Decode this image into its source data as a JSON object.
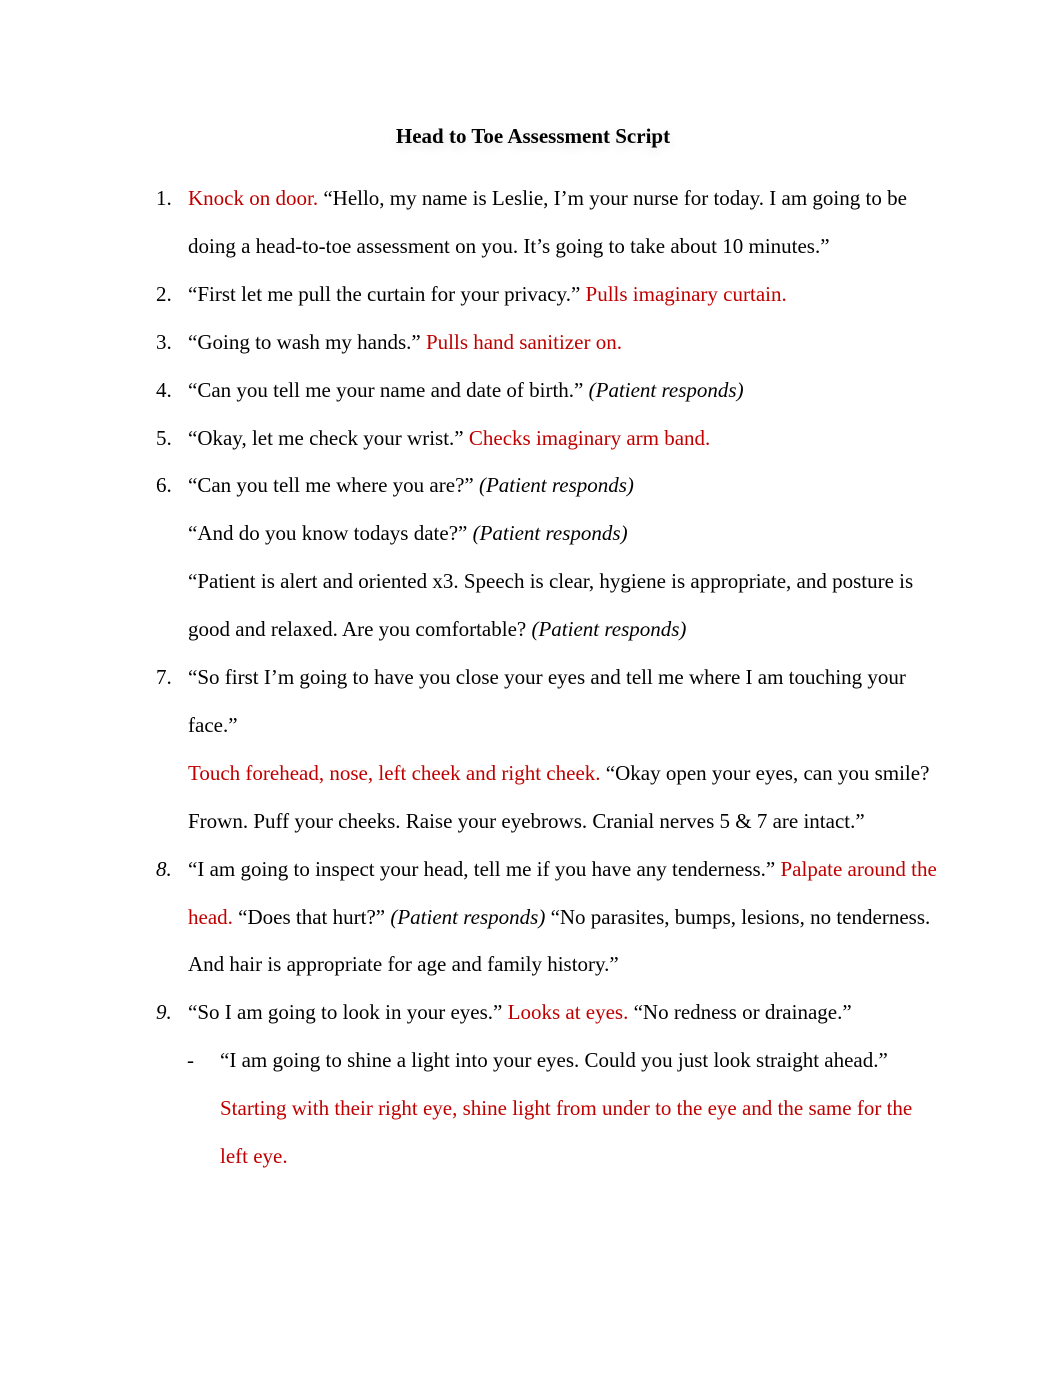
{
  "document": {
    "title": "Head to Toe Assessment Script",
    "colors": {
      "action_text": "#C00000",
      "body_text": "#000000"
    },
    "items": [
      {
        "number": "1.",
        "lines": [
          {
            "segments": [
              {
                "text": "Knock on door.",
                "style": "red"
              },
              {
                "text": " “Hello, my name is Leslie, I’m your nurse for today. I am going to be",
                "style": "normal"
              }
            ]
          },
          {
            "segments": [
              {
                "text": "doing a head-to-toe assessment on you. It’s going to take about 10 minutes.”",
                "style": "normal"
              }
            ]
          }
        ]
      },
      {
        "number": "2.",
        "lines": [
          {
            "segments": [
              {
                "text": "“First let me pull the curtain for your privacy.” ",
                "style": "normal"
              },
              {
                "text": "Pulls imaginary curtain.",
                "style": "red"
              }
            ]
          }
        ]
      },
      {
        "number": "3.",
        "lines": [
          {
            "segments": [
              {
                "text": "“Going to wash my hands.” ",
                "style": "normal"
              },
              {
                "text": "Pulls hand sanitizer on.",
                "style": "red"
              }
            ]
          }
        ]
      },
      {
        "number": "4.",
        "lines": [
          {
            "segments": [
              {
                "text": "“Can you tell me your name and date of birth.” ",
                "style": "normal"
              },
              {
                "text": "(Patient responds)",
                "style": "italic"
              }
            ]
          }
        ]
      },
      {
        "number": "5.",
        "lines": [
          {
            "segments": [
              {
                "text": "“Okay, let me check your wrist.” ",
                "style": "normal"
              },
              {
                "text": "Checks imaginary arm band.",
                "style": "red"
              }
            ]
          }
        ]
      },
      {
        "number": "6.",
        "lines": [
          {
            "segments": [
              {
                "text": "“Can you tell me where you are?” ",
                "style": "normal"
              },
              {
                "text": "(Patient responds)",
                "style": "italic"
              }
            ]
          },
          {
            "segments": [
              {
                "text": "“And do you know todays date?” ",
                "style": "normal"
              },
              {
                "text": "(Patient responds)",
                "style": "italic"
              }
            ]
          },
          {
            "segments": [
              {
                "text": "“Patient is alert and oriented x3. Speech is clear, hygiene is appropriate, and posture is",
                "style": "normal"
              }
            ]
          },
          {
            "segments": [
              {
                "text": "good and relaxed. Are you comfortable? ",
                "style": "normal"
              },
              {
                "text": "(Patient responds)",
                "style": "italic"
              }
            ]
          }
        ]
      },
      {
        "number": "7.",
        "lines": [
          {
            "segments": [
              {
                "text": "“So first I’m going to have you close your eyes and tell me where I am touching your",
                "style": "normal"
              }
            ]
          },
          {
            "segments": [
              {
                "text": "face.”",
                "style": "normal"
              }
            ]
          },
          {
            "segments": [
              {
                "text": "Touch forehead, nose, left cheek and right cheek.",
                "style": "red"
              },
              {
                "text": " “Okay open your eyes, can you smile?",
                "style": "normal"
              }
            ]
          },
          {
            "segments": [
              {
                "text": "Frown. Puff your cheeks. Raise your eyebrows. Cranial nerves 5 & 7 are intact.”",
                "style": "normal"
              }
            ]
          }
        ]
      },
      {
        "number": "8.",
        "number_italic": true,
        "lines": [
          {
            "segments": [
              {
                "text": "“I am going to inspect your head, tell me if you have any tenderness.” ",
                "style": "normal"
              },
              {
                "text": "Palpate around the",
                "style": "red"
              }
            ]
          },
          {
            "segments": [
              {
                "text": "head.",
                "style": "red"
              },
              {
                "text": " “Does that hurt?” ",
                "style": "normal"
              },
              {
                "text": "(Patient responds)",
                "style": "italic"
              },
              {
                "text": " “No parasites, bumps, lesions, no tenderness.",
                "style": "normal"
              }
            ]
          },
          {
            "segments": [
              {
                "text": "And hair is appropriate for age and family history.”",
                "style": "normal"
              }
            ]
          }
        ]
      },
      {
        "number": "9.",
        "number_italic": true,
        "lines": [
          {
            "segments": [
              {
                "text": "“So I am going to look in your eyes.” ",
                "style": "normal"
              },
              {
                "text": "Looks at eyes.",
                "style": "red"
              },
              {
                "text": " “No redness or drainage.”",
                "style": "normal"
              }
            ]
          }
        ],
        "subitems": [
          {
            "bullet": "-",
            "lines": [
              {
                "segments": [
                  {
                    "text": "“I am going to shine a light into your eyes. Could you just look straight ahead.”",
                    "style": "normal"
                  }
                ]
              },
              {
                "segments": [
                  {
                    "text": "Starting with their right eye, shine light from under to the eye and the same for the",
                    "style": "red"
                  }
                ]
              },
              {
                "segments": [
                  {
                    "text": "left eye.",
                    "style": "red"
                  }
                ]
              }
            ]
          }
        ]
      }
    ]
  }
}
